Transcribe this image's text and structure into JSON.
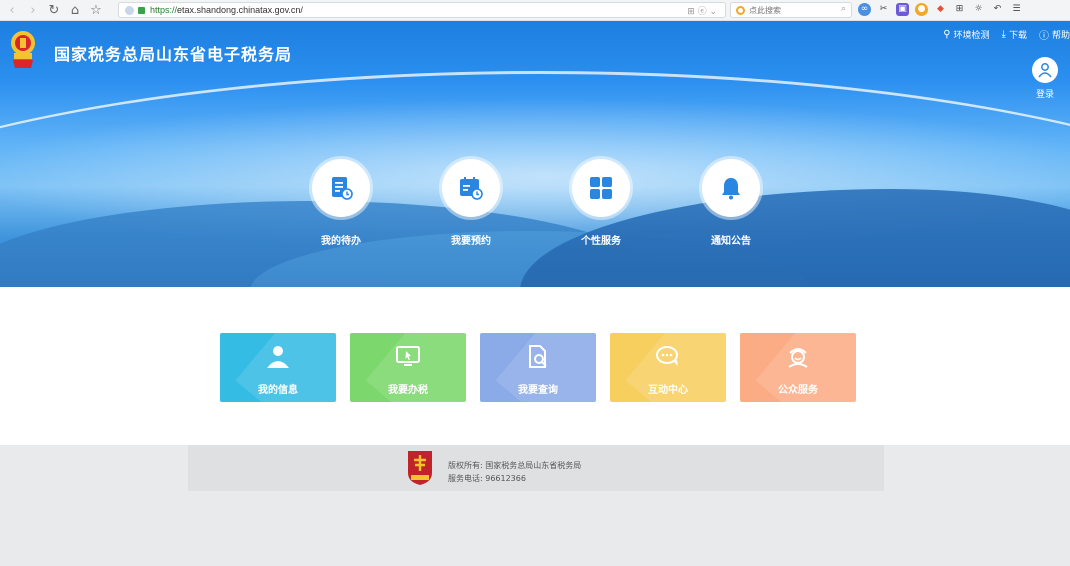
{
  "browser": {
    "url_scheme": "https://",
    "url_host": "etax.shandong.chinatax.gov.cn/",
    "search_placeholder": "点此搜索"
  },
  "site": {
    "title": "国家税务总局山东省电子税务局"
  },
  "top_links": [
    {
      "label": "环境检测",
      "icon": "monitor-check-icon"
    },
    {
      "label": "下载",
      "icon": "download-icon"
    },
    {
      "label": "帮助",
      "icon": "help-icon"
    }
  ],
  "login": {
    "label": "登录",
    "icon": "user-icon"
  },
  "quick_actions": [
    {
      "label": "我的待办",
      "icon": "todo-document-icon"
    },
    {
      "label": "我要预约",
      "icon": "calendar-clock-icon"
    },
    {
      "label": "个性服务",
      "icon": "grid-icon"
    },
    {
      "label": "通知公告",
      "icon": "bell-icon"
    }
  ],
  "tiles": [
    {
      "label": "我的信息",
      "icon": "person-icon",
      "color": "#35bce4"
    },
    {
      "label": "我要办税",
      "icon": "monitor-cursor-icon",
      "color": "#7cd86c"
    },
    {
      "label": "我要查询",
      "icon": "document-search-icon",
      "color": "#8aaae8"
    },
    {
      "label": "互动中心",
      "icon": "chat-bubble-icon",
      "color": "#f7cf5f"
    },
    {
      "label": "公众服务",
      "icon": "service-agent-icon",
      "color": "#fcac84"
    }
  ],
  "footer": {
    "copyright": "版权所有: 国家税务总局山东省税务局",
    "phone": "服务电话: 96612366"
  }
}
